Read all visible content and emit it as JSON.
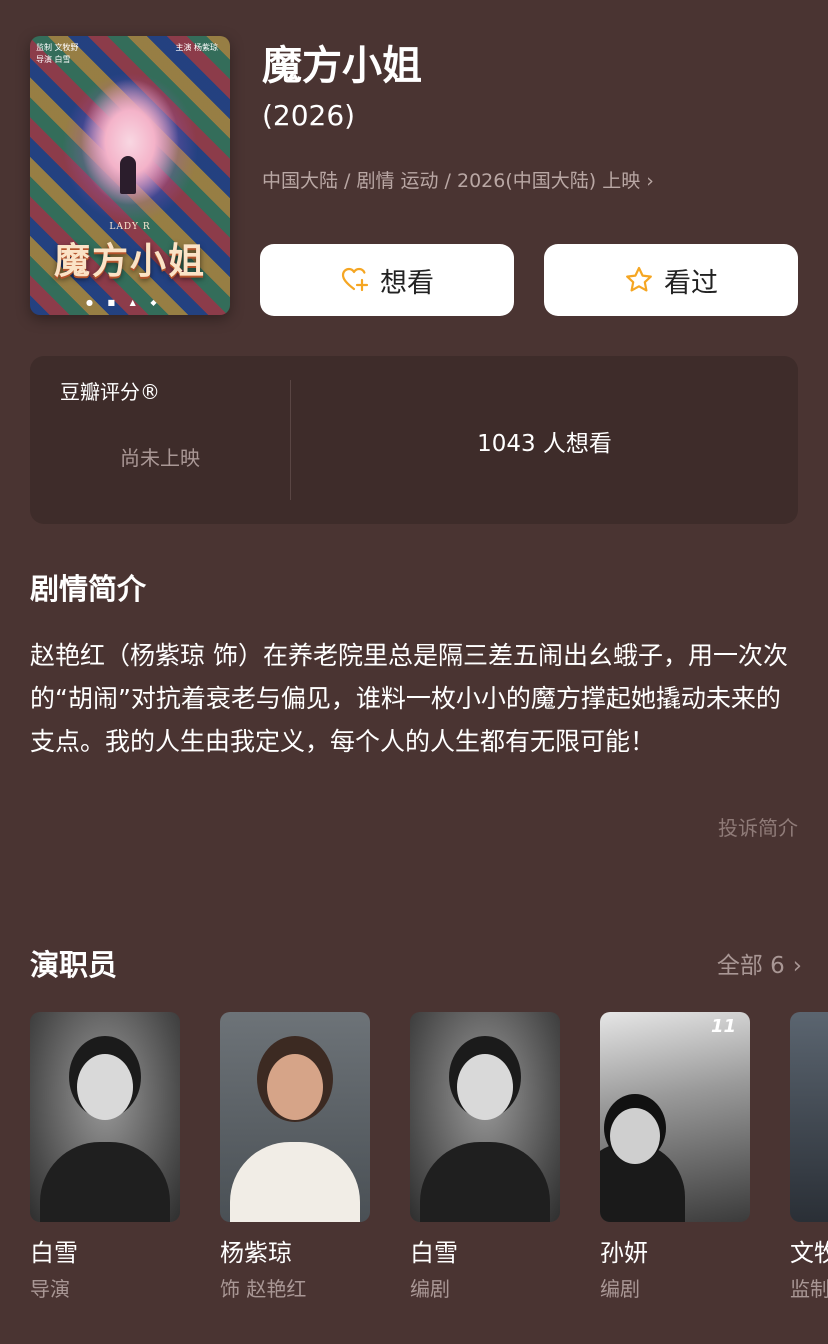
{
  "movie": {
    "title": "魔方小姐",
    "year": "(2026)",
    "meta": "中国大陆 / 剧情 运动 / 2026(中国大陆) 上映",
    "poster": {
      "credit_left_1": "监制 文牧野",
      "credit_left_2": "导演 白雪",
      "credit_right": "主演 杨紫琼",
      "subtitle": "LADY R",
      "title": "魔方小姐"
    }
  },
  "actions": {
    "want_label": "想看",
    "seen_label": "看过",
    "want_icon": "heart-plus-icon",
    "seen_icon": "star-outline-icon",
    "accent_color": "#f5a623"
  },
  "rating": {
    "label": "豆瓣评分®",
    "status": "尚未上映",
    "want_count": "1043 人想看"
  },
  "synopsis": {
    "title": "剧情简介",
    "text": "赵艳红（杨紫琼 饰）在养老院里总是隔三差五闹出幺蛾子，用一次次的“胡闹”对抗着衰老与偏见，谁料一枚小小的魔方撑起她撬动未来的支点。我的人生由我定义，每个人的人生都有无限可能！",
    "report_link": "投诉简介"
  },
  "cast": {
    "title": "演职员",
    "all_label": "全部 6",
    "members": [
      {
        "name": "白雪",
        "role": "导演"
      },
      {
        "name": "杨紫琼",
        "role": "饰 赵艳红"
      },
      {
        "name": "白雪",
        "role": "编剧"
      },
      {
        "name": "孙妍",
        "role": "编剧",
        "photo_badge": "11"
      },
      {
        "name": "文牧",
        "role": "监制"
      }
    ]
  },
  "colors": {
    "background": "#4a3432",
    "panel": "#3e2c2a",
    "muted_text": "#a99795"
  }
}
